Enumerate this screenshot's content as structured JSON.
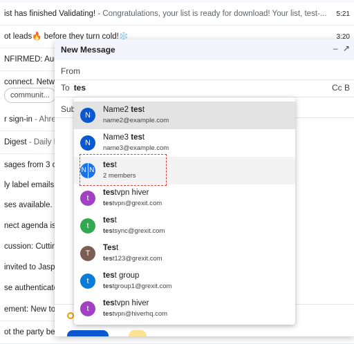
{
  "inbox": {
    "rows": [
      {
        "subject": "ist has finished Validating!",
        "snippet": " - Congratulations, your list is ready for download! Your list, test-...",
        "time": "5:21"
      },
      {
        "subject": "ot leads",
        "emoji": "🔥",
        "subject2": " before they turn cold!",
        "emoji2": "❄️",
        "snippet": "",
        "time": "3:20"
      },
      {
        "subject": "NFIRMED: Audi",
        "snippet": "",
        "time": ""
      },
      {
        "subject": "connect. Netwo",
        "snippet": "",
        "time": ""
      },
      {
        "chip": "communit..."
      },
      {
        "subject": "r sign-in",
        "snippet": " - Ahre",
        "time": ""
      },
      {
        "subject": "Digest",
        "snippet": " - Daily E",
        "time": ""
      },
      {
        "subject": "sages from 3 c",
        "snippet": "",
        "time": ""
      },
      {
        "subject": "ly label emails v",
        "snippet": "",
        "time": ""
      },
      {
        "subject": "ses available.",
        "snippet": " -",
        "time": ""
      },
      {
        "subject": "nect agenda is",
        "snippet": "",
        "time": ""
      },
      {
        "subject": "cussion: Cuttin",
        "snippet": "",
        "time": ""
      },
      {
        "subject": " invited to Jasp",
        "snippet": "",
        "time": ""
      },
      {
        "subject": "se authenticate",
        "snippet": "",
        "time": ""
      },
      {
        "subject": "ement: New to",
        "snippet": "",
        "time": ""
      },
      {
        "subject": "ot the party be",
        "snippet": "",
        "time": ""
      }
    ]
  },
  "compose": {
    "title": "New Message",
    "minimize_icon": "minimize-icon",
    "expand_icon": "expand-icon",
    "from_label": "From",
    "to_label": "To",
    "to_value": "tes",
    "cc_label": "Cc B",
    "subject_label": "Sub"
  },
  "suggestions": [
    {
      "avatar": "N",
      "color": "#0b57d0",
      "name": "Name2 test",
      "email": "name2@example.com",
      "selected": true
    },
    {
      "avatar": "N",
      "color": "#0b57d0",
      "name": "Name3 test",
      "email": "name3@example.com"
    },
    {
      "avatar": "NN",
      "color": "#1a73e8",
      "name": "test",
      "email": "2 members",
      "group": true,
      "hover": true
    },
    {
      "avatar": "t",
      "color": "#a142c3",
      "name": "testvpn hiver",
      "email": "testvpn@grexit.com"
    },
    {
      "avatar": "t",
      "color": "#33a852",
      "name": "test",
      "email": "testsync@grexit.com"
    },
    {
      "avatar": "T",
      "color": "#7b5c52",
      "name": "Test",
      "email": "test123@grexit.com"
    },
    {
      "avatar": "t",
      "color": "#0b7bd9",
      "name": "test group",
      "email": "testgroup1@grexit.com"
    },
    {
      "avatar": "t",
      "color": "#a142c3",
      "name": "testvpn hiver",
      "email": "testvpn@hiverhq.com"
    }
  ]
}
